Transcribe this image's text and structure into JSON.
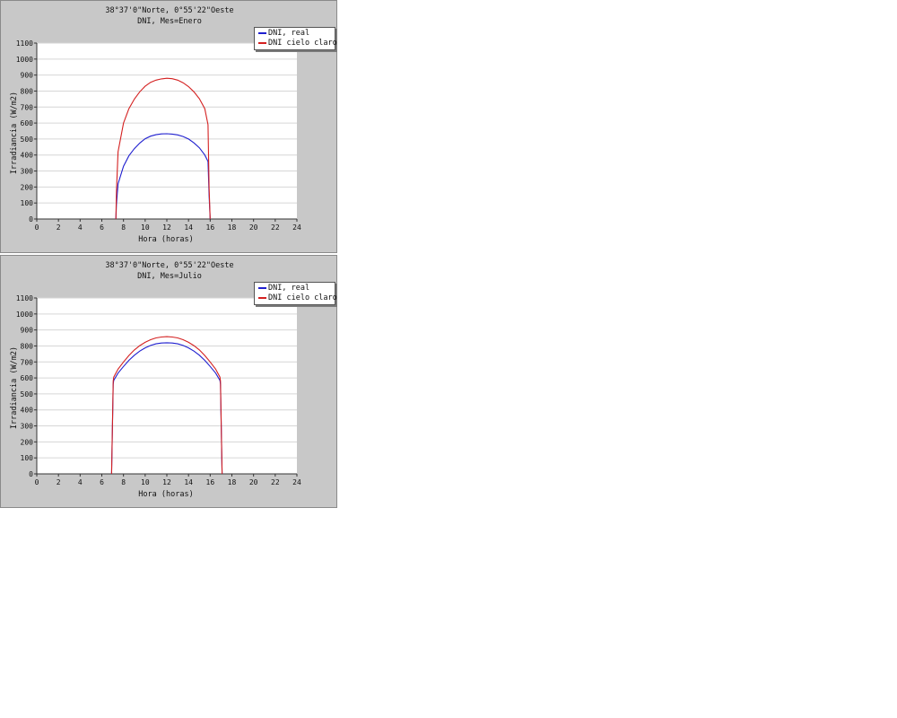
{
  "chart_data": [
    {
      "type": "line",
      "title": "38°37'0\"Norte, 0°55'22\"Oeste",
      "subtitle": "DNI, Mes=Enero",
      "xlabel": "Hora (horas)",
      "ylabel": "Irradiancia (W/m2)",
      "xlim": [
        0,
        24
      ],
      "ylim": [
        0,
        1100
      ],
      "xticks": [
        0,
        2,
        4,
        6,
        8,
        10,
        12,
        14,
        16,
        18,
        20,
        22,
        24
      ],
      "yticks": [
        0,
        100,
        200,
        300,
        400,
        500,
        600,
        700,
        800,
        900,
        1000,
        1100
      ],
      "grid": true,
      "legend_position": "top-right",
      "series": [
        {
          "name": "DNI, real",
          "color": "#1f1fcf",
          "x": [
            7.3,
            7.35,
            7.5,
            8,
            8.5,
            9,
            9.5,
            10,
            10.5,
            11,
            11.5,
            12,
            12.5,
            13,
            13.5,
            14,
            14.5,
            15,
            15.5,
            15.8,
            15.9,
            16.0
          ],
          "y": [
            0,
            90,
            220,
            330,
            395,
            440,
            475,
            502,
            518,
            527,
            532,
            533,
            531,
            526,
            516,
            500,
            476,
            445,
            400,
            360,
            150,
            0
          ]
        },
        {
          "name": "DNI cielo claro",
          "color": "#d42020",
          "x": [
            7.3,
            7.35,
            7.5,
            8,
            8.5,
            9,
            9.5,
            10,
            10.5,
            11,
            11.5,
            12,
            12.5,
            13,
            13.5,
            14,
            14.5,
            15,
            15.5,
            15.8,
            15.9,
            16.0
          ],
          "y": [
            0,
            170,
            420,
            600,
            690,
            750,
            795,
            830,
            855,
            868,
            876,
            880,
            877,
            868,
            852,
            828,
            795,
            752,
            690,
            590,
            200,
            0
          ]
        }
      ]
    },
    {
      "type": "line",
      "title": "38°37'0\"Norte, 0°55'22\"Oeste",
      "subtitle": "DNI, Mes=Julio",
      "xlabel": "Hora (horas)",
      "ylabel": "Irradiancia (W/m2)",
      "xlim": [
        0,
        24
      ],
      "ylim": [
        0,
        1100
      ],
      "xticks": [
        0,
        2,
        4,
        6,
        8,
        10,
        12,
        14,
        16,
        18,
        20,
        22,
        24
      ],
      "yticks": [
        0,
        100,
        200,
        300,
        400,
        500,
        600,
        700,
        800,
        900,
        1000,
        1100
      ],
      "grid": true,
      "legend_position": "top-right",
      "series": [
        {
          "name": "DNI, real",
          "color": "#1f1fcf",
          "x": [
            6.9,
            7.0,
            7.05,
            7.1,
            7.5,
            8,
            8.5,
            9,
            9.5,
            10,
            10.5,
            11,
            11.5,
            12,
            12.5,
            13,
            13.5,
            14,
            14.5,
            15,
            15.5,
            16,
            16.5,
            16.9,
            16.95,
            17.0,
            17.1
          ],
          "y": [
            0,
            370,
            560,
            585,
            630,
            672,
            710,
            742,
            768,
            788,
            803,
            813,
            818,
            820,
            818,
            813,
            803,
            788,
            768,
            742,
            710,
            672,
            630,
            585,
            560,
            370,
            0
          ]
        },
        {
          "name": "DNI cielo claro",
          "color": "#d42020",
          "x": [
            6.9,
            7.0,
            7.05,
            7.1,
            7.5,
            8,
            8.5,
            9,
            9.5,
            10,
            10.5,
            11,
            11.5,
            12,
            12.5,
            13,
            13.5,
            14,
            14.5,
            15,
            15.5,
            16,
            16.5,
            16.9,
            16.95,
            17.0,
            17.1
          ],
          "y": [
            0,
            380,
            580,
            605,
            655,
            700,
            740,
            775,
            802,
            823,
            839,
            850,
            856,
            858,
            856,
            850,
            839,
            823,
            802,
            775,
            740,
            700,
            655,
            605,
            580,
            380,
            0
          ]
        }
      ]
    }
  ]
}
